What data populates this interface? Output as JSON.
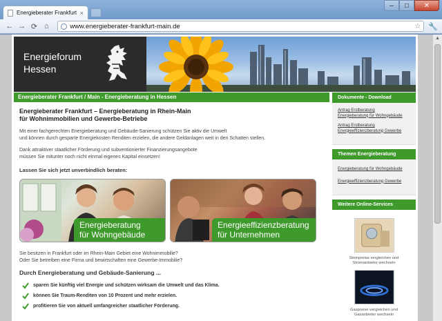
{
  "browser": {
    "tab_title": "Energieberater Frankfurt ...",
    "tab_close": "×",
    "url": "www.energieberater-frankfurt-main.de",
    "back": "←",
    "forward": "→",
    "reload": "⟳",
    "home": "⌂",
    "star": "☆",
    "wrench": "🔧",
    "min": "–",
    "max": "□",
    "close": "✕"
  },
  "header": {
    "brand_line1": "Energieforum",
    "brand_line2": "Hessen"
  },
  "banner": "Energieberater Frankfurt / Main - Energieberatung in Hessen",
  "main": {
    "title_line1": "Energieberater Frankfurt – Energieberatung in Rhein-Main",
    "title_line2": "für Wohnimmobilien und Gewerbe-Betriebe",
    "para1_line1": "Mit einer fachgerechten Energieberatung und Gebäude-Sanierung schützen Sie aktiv die Umwelt",
    "para1_line2": "und können durch gesparte Energiekosten Renditen erzielen, die andere Geldanlagen weit in den Schatten stellen.",
    "para2_line1": "Dank attraktiver staatlicher Förderung und subventionierter Finanzierungsangebote",
    "para2_line2": "müssen Sie mitunter noch nicht einmal eigenes Kapital einsetzen!",
    "cta": "Lassen Sie sich jetzt unverbindlich beraten:",
    "teaser1_line1": "Energieberatung",
    "teaser1_line2": "für Wohngebäude",
    "teaser2_line1": "Energieeffizienzberatung",
    "teaser2_line2": "für Unternehmen",
    "question_line1": "Sie besitzen in Frankfurt oder im Rhein-Main Gebiet eine Wohnimmobilie?",
    "question_line2": "Oder Sie betreiben eine Firma und bewirtschaften eine Gewerbe-Immobilie?",
    "subtitle": "Durch Energieberatung und Gebäude-Sanierung ...",
    "benefits": [
      "sparen Sie künftig viel Energie und schützen wirksam die Umwelt und das Klima.",
      "können Sie Traum-Renditen von 10 Prozent und mehr erzielen.",
      "profitieren Sie von aktuell umfangreicher staatlicher Förderung."
    ]
  },
  "sidebar": {
    "downloads_title": "Dokumente - Download",
    "downloads": [
      [
        "Antrag Erstberatung",
        "Energieberatung für Wohngebäude"
      ],
      [
        "Antrag Erstberatung",
        "Energieeffizienzberatung Gewerbe"
      ]
    ],
    "themes_title": "Themen Energieberatung",
    "themes": [
      "Energieberatung für Wohngebäude",
      "Energieeffizienzberatung Gewerbe"
    ],
    "services_title": "Weitere Online-Services",
    "service1_line1": "Stompreise vergleichen und",
    "service1_line2": "Stromanbieter wechseln",
    "service2_line1": "Gaspreise vergleichen und",
    "service2_line2": "Gasanbieter wechseln"
  },
  "colors": {
    "green": "#3f9a2c",
    "dark": "#2b2b2b"
  }
}
